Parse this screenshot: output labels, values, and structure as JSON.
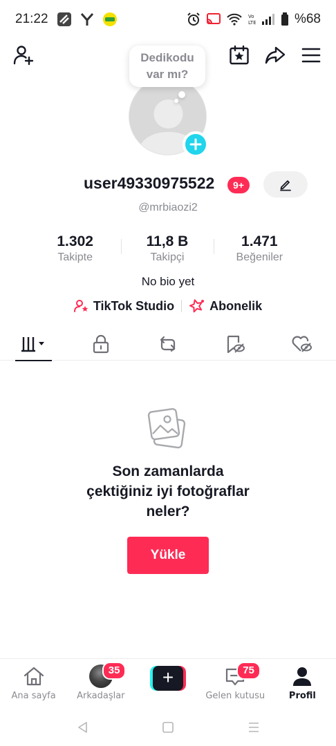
{
  "status_bar": {
    "time": "21:22",
    "battery": "%68",
    "network_label": "Vo\nLTE"
  },
  "profile": {
    "bubble_text_line1": "Dedikodu",
    "bubble_text_line2": "var mı?",
    "username": "user49330975522",
    "notification_badge": "9+",
    "handle": "@mrbiaozi2",
    "bio": "No bio yet"
  },
  "stats": [
    {
      "value": "1.302",
      "label": "Takipte"
    },
    {
      "value": "11,8 B",
      "label": "Takipçi"
    },
    {
      "value": "1.471",
      "label": "Beğeniler"
    }
  ],
  "links": {
    "studio": "TikTok Studio",
    "subscription": "Abonelik"
  },
  "tabs": [
    {
      "icon": "videos-grid-icon",
      "active": true
    },
    {
      "icon": "lock-icon",
      "active": false
    },
    {
      "icon": "repost-icon",
      "active": false
    },
    {
      "icon": "saved-hidden-icon",
      "active": false
    },
    {
      "icon": "liked-hidden-icon",
      "active": false
    }
  ],
  "empty_state": {
    "line1": "Son zamanlarda",
    "line2": "çektiğiniz iyi fotoğraflar",
    "line3": "neler?",
    "button": "Yükle"
  },
  "bottom_nav": {
    "home": "Ana sayfa",
    "friends": "Arkadaşlar",
    "friends_badge": "35",
    "create": "+",
    "inbox": "Gelen kutusu",
    "inbox_badge": "75",
    "profile": "Profil"
  },
  "colors": {
    "accent": "#fe2c55",
    "cyan": "#20d5ec",
    "text": "#161823",
    "muted": "#8a8b91"
  }
}
